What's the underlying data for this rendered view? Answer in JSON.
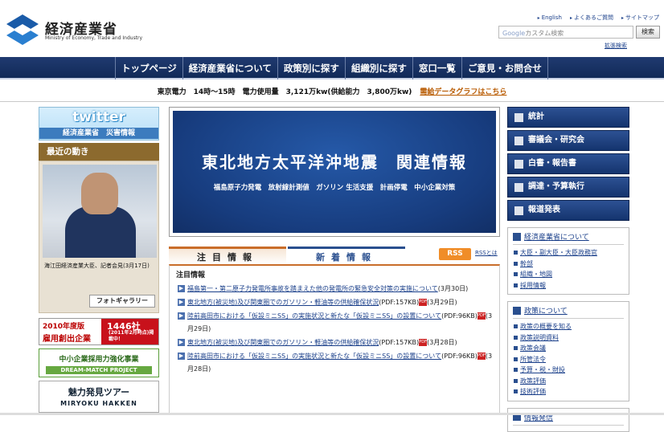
{
  "header": {
    "logo_title": "経済産業省",
    "logo_subtitle": "Ministry of Economy, Trade and Industry",
    "top_links": [
      "English",
      "よくあるご質問",
      "サイトマップ"
    ],
    "search_brand": "Google",
    "search_placeholder": "カスタム検索",
    "search_button": "検索",
    "advanced_link": "拡張検索"
  },
  "nav": {
    "items": [
      "トップページ",
      "経済産業省について",
      "政策別に探す",
      "組織別に探す",
      "窓口一覧",
      "ご意見・お問合せ"
    ]
  },
  "power": {
    "text": "東京電力　14時～15時　電力使用量　3,121万kw(供給能力　3,800万kw)",
    "link": "需給データグラフはこちら"
  },
  "left": {
    "twitter_label": "twitter",
    "twitter_sub": "経済産業省　災害情報",
    "recent_heading": "最近の動き",
    "photo_caption": "海江田経済産業大臣、記者会見(3月17日)",
    "gallery_button": "フォトギャラリー",
    "banner1_a": "2010年度版",
    "banner1_b": "雇用創出企業",
    "banner1_c": "1446社",
    "banner1_d": "(2011年2月時点)掲載中！",
    "banner2_title": "中小企業採用力強化事業",
    "banner2_sub": "DREAM-MATCH PROJECT",
    "banner3_title": "魅力発見ツアー",
    "banner3_sub": "MIRYOKU HAKKEN"
  },
  "hero": {
    "title": "東北地方太平洋沖地震　関連情報",
    "subtitle": "福島原子力発電　放射線計測値　ガソリン 生活支援　計画停電　中小企業対策"
  },
  "tabs": {
    "tab1": "注目情報",
    "tab2": "新着情報",
    "rss": "RSS",
    "rss_what": "RSSとは"
  },
  "news": {
    "heading": "注目情報",
    "items": [
      {
        "title": "福島第一・第二原子力発電所事故を踏まえた他の発電所の緊急安全対策の実施について",
        "date": "(3月30日)",
        "pdf": false,
        "size": ""
      },
      {
        "title": "東北地方(被災地)及び関東圏でのガソリン・軽油等の供給確保状況",
        "date": "(3月29日)",
        "pdf": true,
        "size": "(PDF:157KB)"
      },
      {
        "title": "陸前高田市における「仮設ミニSS」の実施状況と新たな「仮設ミニSS」の設置について",
        "date": "(3月29日)",
        "pdf": true,
        "size": "(PDF:96KB)"
      },
      {
        "title": "東北地方(被災地)及び関東圏でのガソリン・軽油等の供給確保状況",
        "date": "(3月28日)",
        "pdf": true,
        "size": "(PDF:157KB)"
      },
      {
        "title": "陸前高田市における「仮設ミニSS」の実施状況と新たな「仮設ミニSS」の設置について",
        "date": "(3月28日)",
        "pdf": true,
        "size": "(PDF:96KB)"
      }
    ]
  },
  "right": {
    "buttons": [
      "統計",
      "審議会・研究会",
      "白書・報告書",
      "調達・予算執行",
      "報道発表"
    ],
    "box1_head": "経済産業省について",
    "box1_links": [
      "大臣・副大臣・大臣政務官",
      "幹部",
      "組織・地図",
      "採用情報"
    ],
    "box2_head": "政策について",
    "box2_links": [
      "政策の概要を知る",
      "政策説明資料",
      "政策会議",
      "所管法令",
      "予算・税・財投",
      "政策評価",
      "技術評価"
    ],
    "box3_head": "情報発信"
  }
}
